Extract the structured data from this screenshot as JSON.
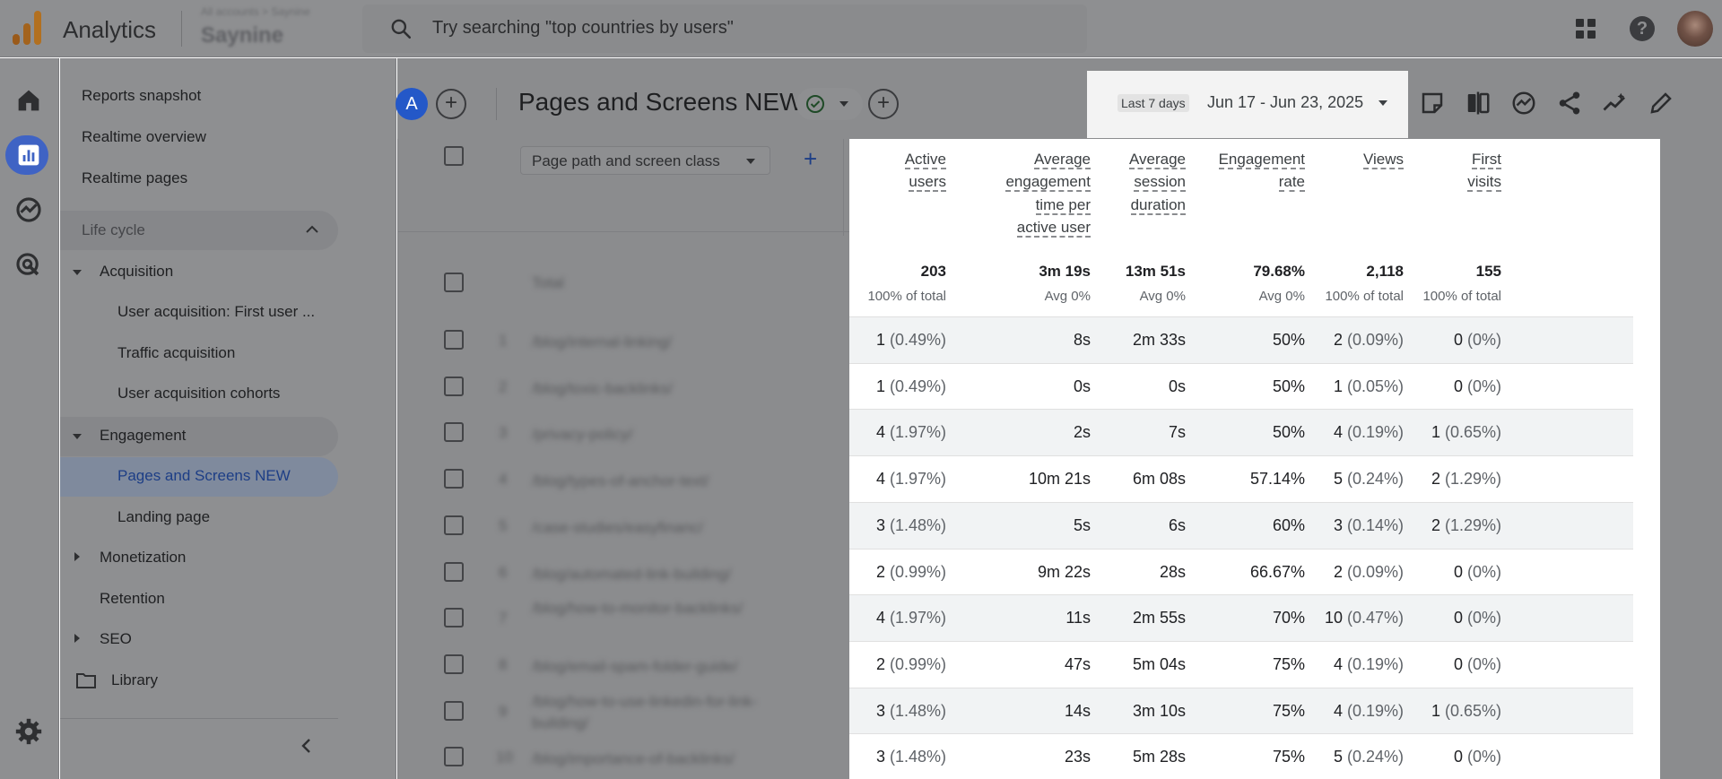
{
  "topbar": {
    "app_title": "Analytics",
    "account_path": "All accounts > Saynine",
    "property_name": "Saynine",
    "search_placeholder": "Try searching \"top countries by users\""
  },
  "nav": {
    "items": [
      {
        "label": "Reports snapshot"
      },
      {
        "label": "Realtime overview"
      },
      {
        "label": "Realtime pages"
      }
    ],
    "section": "Life cycle",
    "acquisition": "Acquisition",
    "acquisition_items": [
      "User acquisition: First user ...",
      "Traffic acquisition",
      "User acquisition cohorts"
    ],
    "engagement": "Engagement",
    "engagement_items": [
      "Pages and Screens NEW",
      "Landing page"
    ],
    "monetization": "Monetization",
    "retention": "Retention",
    "seo": "SEO",
    "library": "Library"
  },
  "header": {
    "avatar_letter": "A",
    "title": "Pages and Screens NEW",
    "date_chip": "Last 7 days",
    "date_range": "Jun 17 - Jun 23, 2025"
  },
  "filter": {
    "label": "Page path and screen class",
    "total_label": "Total"
  },
  "columns": [
    {
      "label1": "Active",
      "label2": "users",
      "label3": "",
      "label4": ""
    },
    {
      "label1": "Average",
      "label2": "engagement",
      "label3": "time per",
      "label4": "active user"
    },
    {
      "label1": "Average",
      "label2": "session",
      "label3": "duration",
      "label4": ""
    },
    {
      "label1": "Engagement",
      "label2": "rate",
      "label3": "",
      "label4": ""
    },
    {
      "label1": "Views",
      "label2": "",
      "label3": "",
      "label4": ""
    },
    {
      "label1": "First",
      "label2": "visits",
      "label3": "",
      "label4": ""
    }
  ],
  "totals": [
    {
      "value": "203",
      "sub": "100% of total"
    },
    {
      "value": "3m 19s",
      "sub": "Avg 0%"
    },
    {
      "value": "13m 51s",
      "sub": "Avg 0%"
    },
    {
      "value": "79.68%",
      "sub": "Avg 0%"
    },
    {
      "value": "2,118",
      "sub": "100% of total"
    },
    {
      "value": "155",
      "sub": "100% of total"
    }
  ],
  "rows": [
    {
      "num": "1",
      "page": "/blog/internal-linking/",
      "active": "1",
      "active_pct": "(0.49%)",
      "eng_time": "8s",
      "session": "2m 33s",
      "rate": "50%",
      "views": "2",
      "views_pct": "(0.09%)",
      "first": "0",
      "first_pct": "(0%)"
    },
    {
      "num": "2",
      "page": "/blog/toxic-backlinks/",
      "active": "1",
      "active_pct": "(0.49%)",
      "eng_time": "0s",
      "session": "0s",
      "rate": "50%",
      "views": "1",
      "views_pct": "(0.05%)",
      "first": "0",
      "first_pct": "(0%)"
    },
    {
      "num": "3",
      "page": "/privacy-policy/",
      "active": "4",
      "active_pct": "(1.97%)",
      "eng_time": "2s",
      "session": "7s",
      "rate": "50%",
      "views": "4",
      "views_pct": "(0.19%)",
      "first": "1",
      "first_pct": "(0.65%)"
    },
    {
      "num": "4",
      "page": "/blog/types-of-anchor-text/",
      "active": "4",
      "active_pct": "(1.97%)",
      "eng_time": "10m 21s",
      "session": "6m 08s",
      "rate": "57.14%",
      "views": "5",
      "views_pct": "(0.24%)",
      "first": "2",
      "first_pct": "(1.29%)"
    },
    {
      "num": "5",
      "page": "/case-studies/easyfinanc/",
      "active": "3",
      "active_pct": "(1.48%)",
      "eng_time": "5s",
      "session": "6s",
      "rate": "60%",
      "views": "3",
      "views_pct": "(0.14%)",
      "first": "2",
      "first_pct": "(1.29%)"
    },
    {
      "num": "6",
      "page": "/blog/automated-link-building/",
      "active": "2",
      "active_pct": "(0.99%)",
      "eng_time": "9m 22s",
      "session": "28s",
      "rate": "66.67%",
      "views": "2",
      "views_pct": "(0.09%)",
      "first": "0",
      "first_pct": "(0%)"
    },
    {
      "num": "7",
      "page": "/blog/how-to-monitor-backlinks/",
      "active": "4",
      "active_pct": "(1.97%)",
      "eng_time": "11s",
      "session": "2m 55s",
      "rate": "70%",
      "views": "10",
      "views_pct": "(0.47%)",
      "first": "0",
      "first_pct": "(0%)"
    },
    {
      "num": "8",
      "page": "/blog/email-spam-folder-guide/",
      "active": "2",
      "active_pct": "(0.99%)",
      "eng_time": "47s",
      "session": "5m 04s",
      "rate": "75%",
      "views": "4",
      "views_pct": "(0.19%)",
      "first": "0",
      "first_pct": "(0%)"
    },
    {
      "num": "9",
      "page": "/blog/how-to-use-linkedin-for-link-building/",
      "active": "3",
      "active_pct": "(1.48%)",
      "eng_time": "14s",
      "session": "3m 10s",
      "rate": "75%",
      "views": "4",
      "views_pct": "(0.19%)",
      "first": "1",
      "first_pct": "(0.65%)"
    },
    {
      "num": "10",
      "page": "/blog/importance-of-backlinks/",
      "active": "3",
      "active_pct": "(1.48%)",
      "eng_time": "23s",
      "session": "5m 28s",
      "rate": "75%",
      "views": "5",
      "views_pct": "(0.24%)",
      "first": "0",
      "first_pct": "(0%)"
    }
  ],
  "colors": {
    "overlay": "#8b8c8e",
    "accent": "#1a73e8",
    "active_nav": "#3f63c4",
    "row_shade": "#f1f3f4"
  }
}
